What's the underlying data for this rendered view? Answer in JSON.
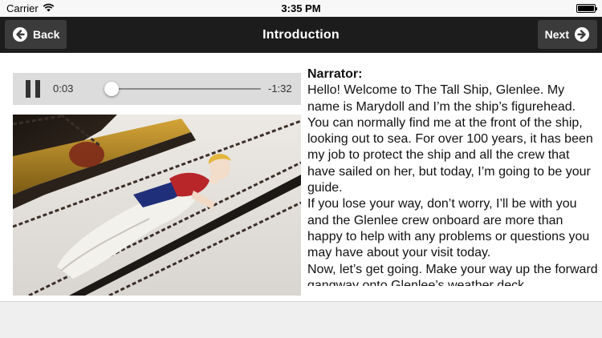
{
  "status_bar": {
    "carrier": "Carrier",
    "time": "3:35 PM",
    "icons": [
      "wifi-icon",
      "battery-icon"
    ]
  },
  "nav": {
    "title": "Introduction",
    "back_label": "Back",
    "next_label": "Next",
    "back_icon": "arrow-left-icon",
    "next_icon": "arrow-right-icon"
  },
  "player": {
    "elapsed": "0:03",
    "remaining": "-1:32",
    "progress_fraction": 0.03,
    "state_icon": "pause-icon"
  },
  "narration": {
    "speaker": "Narrator:",
    "paragraphs": [
      "Hello! Welcome to The Tall Ship, Glenlee. My name is Marydoll and I’m the ship’s figurehead. You can normally find me at the front of the ship, looking out to sea. For over 100 years, it has been my job to protect the ship and all the crew that have sailed on her, but today, I’m going to be your guide.",
      "If you lose your way, don’t worry, I’ll be with you and the Glenlee crew onboard are more than happy to help with any problems or questions you may have about your visit today.",
      "Now, let’s get going. Make your way up the forward gangway onto Glenlee’s weather deck."
    ]
  },
  "colors": {
    "navbar": "#1c1c1c",
    "nav_button": "#3b3b3b",
    "player_bg": "#dcdcdc",
    "content_bg": "#ffffff",
    "footer_bg": "#efefef"
  }
}
